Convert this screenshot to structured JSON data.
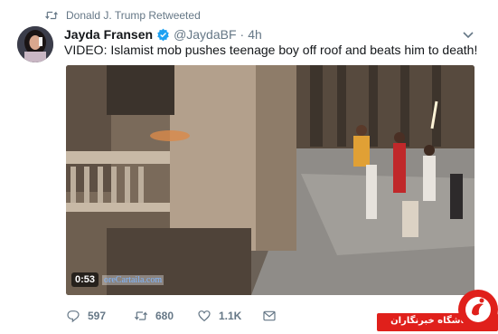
{
  "retweet": {
    "text": "Donald J. Trump Retweeted",
    "icon": "retweet-icon"
  },
  "author": {
    "name": "Jayda Fransen",
    "verified": true,
    "handle": "@JaydaBF",
    "separator": "·",
    "time": "4h",
    "avatar": "avatar-image"
  },
  "tweet": {
    "text": "VIDEO: Islamist mob pushes teenage boy off roof and beats him to death!"
  },
  "video": {
    "duration": "0:53",
    "watermark": "oreCartaila.com"
  },
  "actions": {
    "reply_count": "597",
    "retweet_count": "680",
    "like_count": "1.1K"
  },
  "badge": {
    "text": "باشگاه خبرنگاران",
    "color": "#e0201b"
  },
  "colors": {
    "secondary_text": "#657786",
    "primary_text": "#14171a",
    "verified_blue": "#1da1f2"
  }
}
